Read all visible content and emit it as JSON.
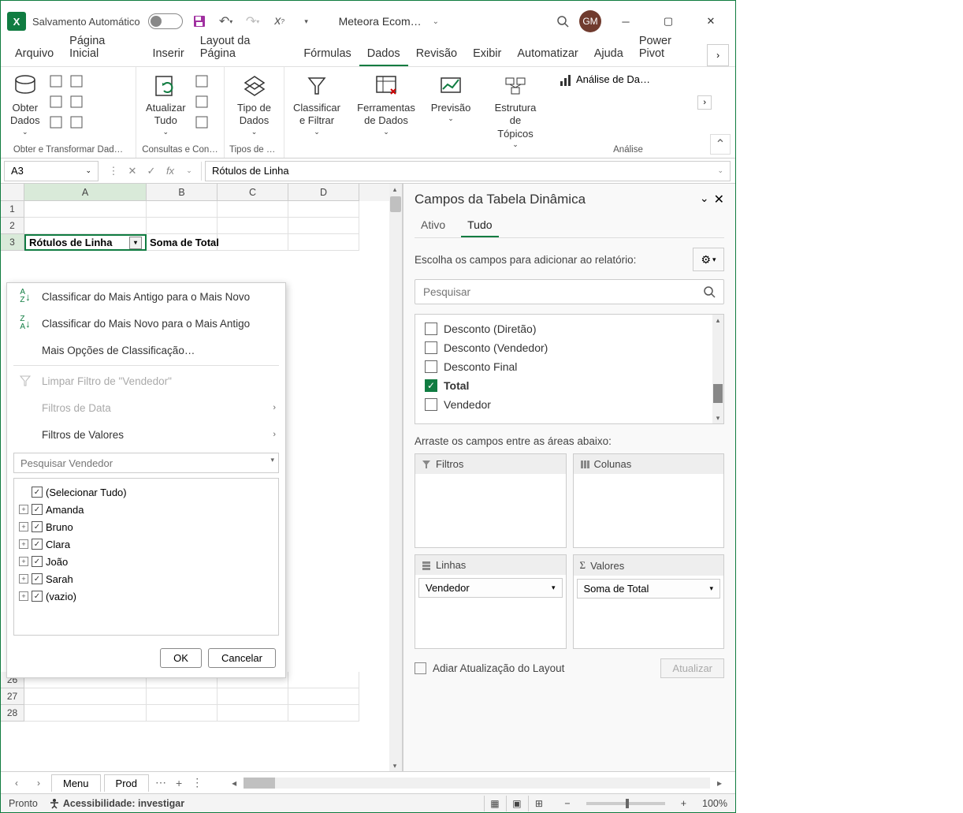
{
  "titlebar": {
    "autosave_label": "Salvamento Automático",
    "doc_name": "Meteora Ecom…",
    "avatar": "GM"
  },
  "ribbon_tabs": [
    "Arquivo",
    "Página Inicial",
    "Inserir",
    "Layout da Página",
    "Fórmulas",
    "Dados",
    "Revisão",
    "Exibir",
    "Automatizar",
    "Ajuda",
    "Power Pivot"
  ],
  "ribbon_active": 5,
  "ribbon": {
    "group1": {
      "label": "Obter e Transformar Dad…",
      "btn1": "Obter\nDados"
    },
    "group2": {
      "label": "Consultas e Con…",
      "btn1": "Atualizar\nTudo"
    },
    "group3": {
      "label": "Tipos de D…",
      "btn1": "Tipo de\nDados"
    },
    "group4": {
      "btn1": "Classificar\ne Filtrar"
    },
    "group5": {
      "btn1": "Ferramentas\nde Dados"
    },
    "group6": {
      "btn1": "Previsão"
    },
    "group7": {
      "btn1": "Estrutura de\nTópicos"
    },
    "analysis_btn": "Análise de Da…",
    "analysis_label": "Análise"
  },
  "formula_bar": {
    "namebox": "A3",
    "formula": "Rótulos de Linha"
  },
  "columns": [
    "A",
    "B",
    "C",
    "D"
  ],
  "row3_A": "Rótulos de Linha",
  "row3_B": "Soma de Total",
  "menu": {
    "sort_asc": "Classificar do Mais Antigo para o Mais Novo",
    "sort_desc": "Classificar do Mais Novo para o Mais Antigo",
    "more_sort": "Mais Opções de Classificação…",
    "clear_filter": "Limpar Filtro de \"Vendedor\"",
    "date_filters": "Filtros de Data",
    "value_filters": "Filtros de Valores",
    "search_placeholder": "Pesquisar Vendedor",
    "items": [
      "(Selecionar Tudo)",
      "Amanda",
      "Bruno",
      "Clara",
      "João",
      "Sarah",
      "(vazio)"
    ],
    "ok": "OK",
    "cancel": "Cancelar"
  },
  "pivot": {
    "title": "Campos da Tabela Dinâmica",
    "tab_active": "Ativo",
    "tab_all": "Tudo",
    "choose_label": "Escolha os campos para adicionar ao relatório:",
    "search_placeholder": "Pesquisar",
    "fields": [
      {
        "label": "Desconto  (Diretão)",
        "checked": false
      },
      {
        "label": "Desconto  (Vendedor)",
        "checked": false
      },
      {
        "label": "Desconto Final",
        "checked": false
      },
      {
        "label": "Total",
        "checked": true
      },
      {
        "label": "Vendedor",
        "checked": false
      }
    ],
    "drag_label": "Arraste os campos entre as áreas abaixo:",
    "filters_label": "Filtros",
    "columns_label": "Colunas",
    "rows_label": "Linhas",
    "rows_field": "Vendedor",
    "values_label": "Valores",
    "values_field": "Soma de Total",
    "defer_label": "Adiar Atualização do Layout",
    "update_btn": "Atualizar"
  },
  "sheets": {
    "s1": "Menu",
    "s2": "Prod"
  },
  "status": {
    "ready": "Pronto",
    "accessibility": "Acessibilidade: investigar",
    "zoom": "100%"
  }
}
